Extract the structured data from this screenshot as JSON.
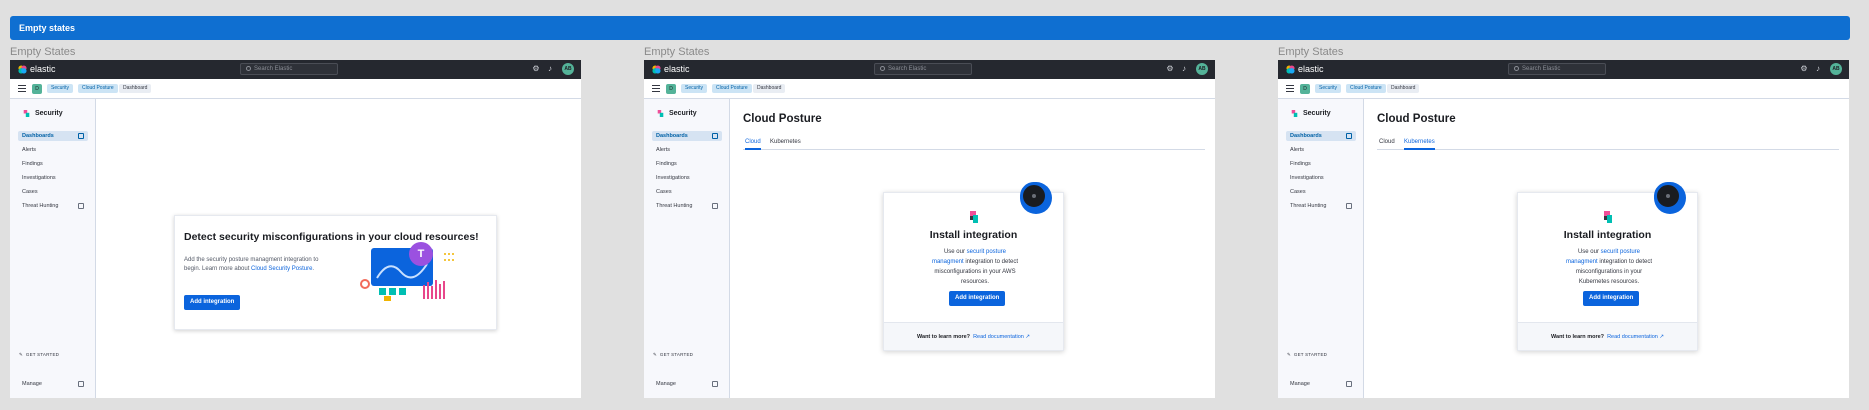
{
  "banner": {
    "title": "Empty states"
  },
  "frames": [
    {
      "label": "Empty States",
      "app": {
        "logo": "elastic",
        "search_placeholder": "Search Elastic",
        "avatar": "AB"
      },
      "breadcrumbs": {
        "space": "D",
        "items": [
          "Security",
          "Cloud Posture",
          "Dashboard"
        ]
      },
      "sidebar": {
        "title": "Security",
        "items": [
          "Dashboards",
          "Alerts",
          "Findings",
          "Investigations",
          "Cases",
          "Threat Hunting"
        ],
        "get_started": "GET STARTED",
        "manage": "Manage"
      },
      "panel": {
        "title": "Detect security misconfigurations in your cloud resources!",
        "desc_text": "Add the security posture managment integration to begin. Learn more about ",
        "desc_link": "Cloud Security Posture",
        "desc_end": ".",
        "button": "Add integration",
        "avatar_letter": "T"
      }
    },
    {
      "label": "Empty States",
      "app": {
        "logo": "elastic",
        "search_placeholder": "Search Elastic",
        "avatar": "AB"
      },
      "breadcrumbs": {
        "space": "D",
        "items": [
          "Security",
          "Cloud Posture",
          "Dashboard"
        ]
      },
      "sidebar": {
        "title": "Security",
        "items": [
          "Dashboards",
          "Alerts",
          "Findings",
          "Investigations",
          "Cases",
          "Threat Hunting"
        ],
        "get_started": "GET STARTED",
        "manage": "Manage"
      },
      "page": {
        "title": "Cloud Posture",
        "tabs": [
          "Cloud",
          "Kubernetes"
        ],
        "selected_tab": 0,
        "card_title": "Install integration",
        "body_pre": "Use our ",
        "body_link": "securit posture managment",
        "body_post": " integration to detect misconfigurations in your AWS resources.",
        "button": "Add integration",
        "footer_q": "Want to learn more?",
        "footer_link": "Read documentation"
      }
    },
    {
      "label": "Empty States",
      "app": {
        "logo": "elastic",
        "search_placeholder": "Search Elastic",
        "avatar": "AB"
      },
      "breadcrumbs": {
        "space": "D",
        "items": [
          "Security",
          "Cloud Posture",
          "Dashboard"
        ]
      },
      "sidebar": {
        "title": "Security",
        "items": [
          "Dashboards",
          "Alerts",
          "Findings",
          "Investigations",
          "Cases",
          "Threat Hunting"
        ],
        "get_started": "GET STARTED",
        "manage": "Manage"
      },
      "page": {
        "title": "Cloud Posture",
        "tabs": [
          "Cloud",
          "Kubernetes"
        ],
        "selected_tab": 1,
        "card_title": "Install integration",
        "body_pre": "Use our ",
        "body_link": "securit posture managment",
        "body_post": " integration to detect misconfigurations in your Kubernetes resources.",
        "button": "Add integration",
        "footer_q": "Want to learn more?",
        "footer_link": "Read documentation"
      }
    }
  ],
  "colors": {
    "accent": "#0b64dd",
    "banner": "#0f6fd1",
    "topbar": "#25282f"
  }
}
